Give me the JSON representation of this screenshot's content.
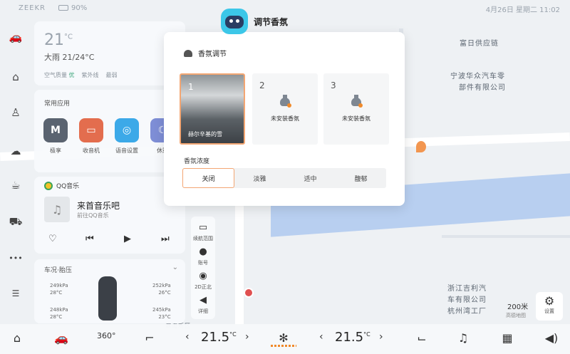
{
  "statusbar": {
    "brand": "ZEEKR",
    "battery": "90%",
    "clock": "4月26日 星期二 11:02"
  },
  "weather": {
    "temp": "21",
    "unit": "°C",
    "desc": "大雨 21/24°C",
    "air_label": "空气质量",
    "air_value": "优",
    "uv_label": "紫外线",
    "uv_value": "最弱"
  },
  "apps": {
    "title": "常用应用",
    "items": [
      {
        "label": "极享",
        "icon": "M",
        "color": "#5a6370"
      },
      {
        "label": "收音机",
        "icon": "▭",
        "color": "#e36d4e"
      },
      {
        "label": "语音设置",
        "icon": "◎",
        "color": "#3ca9e8"
      },
      {
        "label": "休憩",
        "icon": "☾",
        "color": "#7e8ed6"
      }
    ]
  },
  "music": {
    "app": "QQ音乐",
    "song": "来首音乐吧",
    "sub": "前往QQ音乐"
  },
  "car": {
    "title": "车况·胎压",
    "tyres": {
      "fl": {
        "pressure": "249kPa",
        "temp": "28°C"
      },
      "fr": {
        "pressure": "252kPa",
        "temp": "26°C"
      },
      "rl": {
        "pressure": "248kPa",
        "temp": "28°C"
      },
      "rr": {
        "pressure": "245kPa",
        "temp": "23°C"
      }
    }
  },
  "maptools": [
    {
      "icon": "battery-icon",
      "label": "续航范围"
    },
    {
      "icon": "user-icon",
      "label": "账号"
    },
    {
      "icon": "compass-icon",
      "label": "2D正北"
    },
    {
      "icon": "speaker-icon",
      "label": "详细"
    }
  ],
  "map": {
    "labels": [
      "富日供应链",
      "宁波华众汽车零",
      "部件有限公司",
      "浙江吉利汽",
      "车有限公司",
      "杭州湾工厂",
      "滨海新区"
    ],
    "scale": "200米",
    "scale_sub": "高德地图",
    "settings_label": "设置"
  },
  "dialog": {
    "title": "调节香氛",
    "section": "香氛调节",
    "slots": [
      {
        "num": "1",
        "label": "赫尔辛基的雪"
      },
      {
        "num": "2",
        "label": "未安装香氛"
      },
      {
        "num": "3",
        "label": "未安装香氛"
      }
    ],
    "concentration_title": "香氛浓度",
    "levels": [
      "关闭",
      "淡雅",
      "适中",
      "馥郁"
    ],
    "selected_level": "关闭",
    "selected_slot": "1"
  },
  "climate": {
    "left_temp": "21.5",
    "right_temp": "21.5",
    "unit": "°C"
  },
  "colors": {
    "accent": "#f3a673",
    "fan": "#f08a2b"
  }
}
